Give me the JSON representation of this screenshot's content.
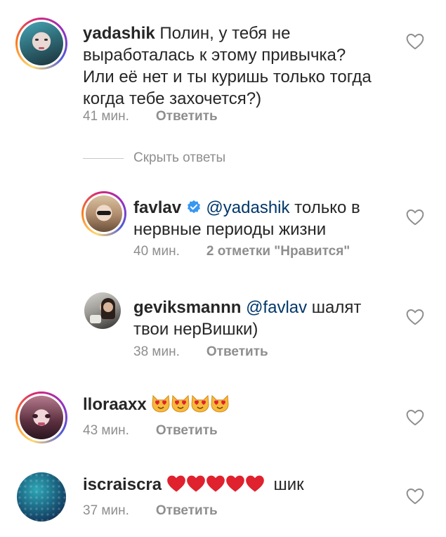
{
  "comments": [
    {
      "username": "yadashik",
      "text": "Полин, у тебя не выработалась к этому привычка? Или её нет и ты куришь только тогда когда тебе захочется?)",
      "time": "41 мин.",
      "action": "Ответить"
    },
    {
      "username": "favlav",
      "verified": true,
      "mention": "@yadashik",
      "text": "только в нервные периоды жизни",
      "time": "40 мин.",
      "action": "2 отметки \"Нравится\""
    },
    {
      "username": "geviksmannn",
      "mention": "@favlav",
      "text": "шалят твои нерВишки)",
      "time": "38 мин.",
      "action": "Ответить"
    },
    {
      "username": "lloraaxx",
      "emoji": "heart-eyes-cat x4",
      "time": "43 мин.",
      "action": "Ответить"
    },
    {
      "username": "iscraiscra",
      "emoji": "red-heart x5",
      "text": "шик",
      "time": "37 мин.",
      "action": "Ответить"
    }
  ],
  "hide_replies": "Скрыть ответы",
  "colors": {
    "text": "#262626",
    "secondary": "#8e8e8e",
    "mention": "#00376b",
    "verified": "#3897f0"
  }
}
